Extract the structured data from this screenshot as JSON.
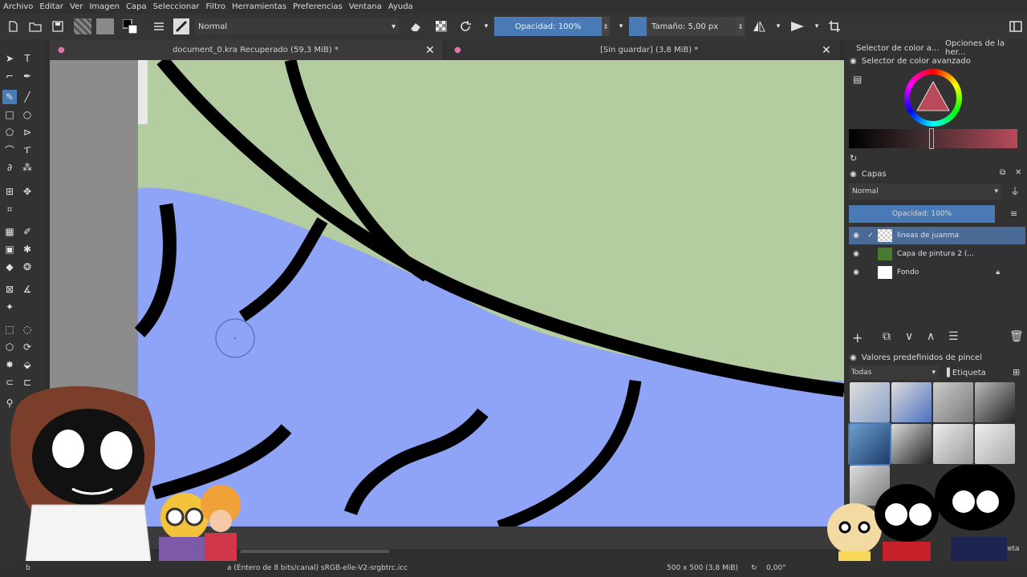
{
  "menu": [
    "Archivo",
    "Editar",
    "Ver",
    "Imagen",
    "Capa",
    "Seleccionar",
    "Filtro",
    "Herramientas",
    "Preferencias",
    "Ventana",
    "Ayuda"
  ],
  "toolbar": {
    "blend_mode": "Normal",
    "opacity_label": "Opacidad: 100%",
    "size_label": "Tamaño: 5,00 px"
  },
  "tabs": [
    {
      "title": "document_0.kra Recuperado (59,3 MiB) *"
    },
    {
      "title": "[Sin guardar]  (3,8 MiB) *"
    }
  ],
  "docker": {
    "top_tabs": [
      "Selector de color a...",
      "Opciones de la her..."
    ],
    "color_selector_title": "Selector de color avanzado",
    "layers_title": "Capas",
    "layers_blend": "Normal",
    "layers_opacity": "Opacidad:  100%",
    "layers": [
      {
        "name": "lineas de juanma"
      },
      {
        "name": "Capa de pintura 2 (..."
      },
      {
        "name": "Fondo"
      }
    ],
    "presets_title": "Valores predefinidos de pincel",
    "presets_filter": "Todas",
    "presets_tag": "Etiqueta",
    "presets_tag_bottom": "iqueta"
  },
  "status": {
    "color_space": "a (Entero de 8 bits/canal)  sRGB-elle-V2-srgbtrc.icc",
    "dimensions": "500 x 500 (3,8 MiB)",
    "rotation": "0,00°",
    "left_char": "b"
  },
  "colors": {
    "accent": "#4a7ab5",
    "canvas_green": "#b5cda0",
    "canvas_blue": "#8fa4f6"
  }
}
